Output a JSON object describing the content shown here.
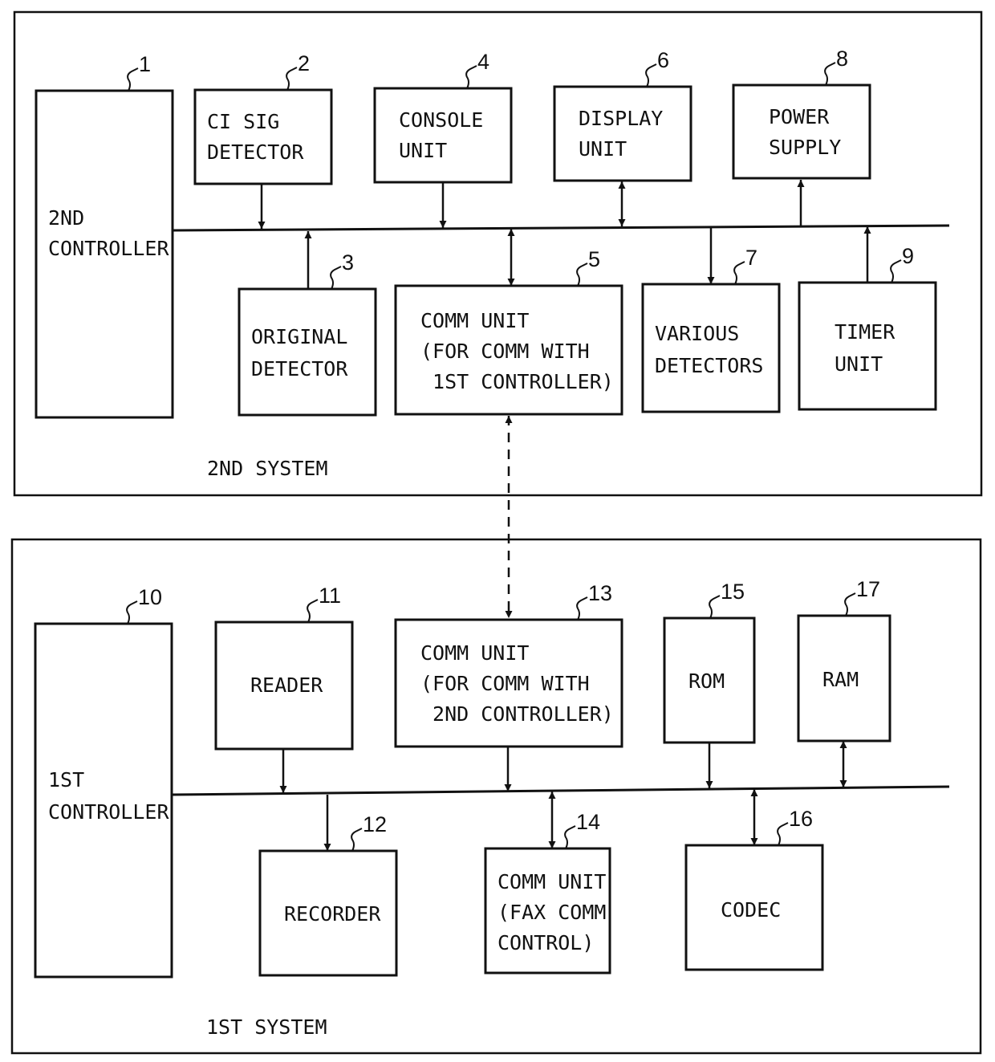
{
  "systems": [
    {
      "id": "second",
      "label": "2ND SYSTEM"
    },
    {
      "id": "first",
      "label": "1ST SYSTEM"
    }
  ],
  "blocks": [
    {
      "ref": "1",
      "lines": [
        "2ND",
        "CONTROLLER"
      ],
      "name": "second-controller"
    },
    {
      "ref": "2",
      "lines": [
        "CI SIG",
        "DETECTOR"
      ],
      "name": "ci-sig-detector"
    },
    {
      "ref": "3",
      "lines": [
        "ORIGINAL",
        "DETECTOR"
      ],
      "name": "original-detector"
    },
    {
      "ref": "4",
      "lines": [
        "CONSOLE",
        "UNIT"
      ],
      "name": "console-unit"
    },
    {
      "ref": "5",
      "lines": [
        "COMM UNIT",
        "(FOR COMM WITH",
        " 1ST CONTROLLER)"
      ],
      "name": "comm-unit-second"
    },
    {
      "ref": "6",
      "lines": [
        "DISPLAY",
        "UNIT"
      ],
      "name": "display-unit"
    },
    {
      "ref": "7",
      "lines": [
        "VARIOUS",
        "DETECTORS"
      ],
      "name": "various-detectors"
    },
    {
      "ref": "8",
      "lines": [
        "POWER",
        "SUPPLY"
      ],
      "name": "power-supply"
    },
    {
      "ref": "9",
      "lines": [
        "TIMER",
        "UNIT"
      ],
      "name": "timer-unit"
    },
    {
      "ref": "10",
      "lines": [
        "1ST",
        "CONTROLLER"
      ],
      "name": "first-controller"
    },
    {
      "ref": "11",
      "lines": [
        "READER"
      ],
      "name": "reader"
    },
    {
      "ref": "12",
      "lines": [
        "RECORDER"
      ],
      "name": "recorder"
    },
    {
      "ref": "13",
      "lines": [
        "COMM UNIT",
        "(FOR COMM WITH",
        " 2ND CONTROLLER)"
      ],
      "name": "comm-unit-first"
    },
    {
      "ref": "14",
      "lines": [
        "COMM UNIT",
        "(FAX COMM",
        "CONTROL)"
      ],
      "name": "comm-unit-fax"
    },
    {
      "ref": "15",
      "lines": [
        "ROM"
      ],
      "name": "rom"
    },
    {
      "ref": "16",
      "lines": [
        "CODEC"
      ],
      "name": "codec"
    },
    {
      "ref": "17",
      "lines": [
        "RAM"
      ],
      "name": "ram"
    }
  ],
  "connections": [
    {
      "from": "2",
      "to": "bus-second",
      "direction": "to-bus"
    },
    {
      "from": "4",
      "to": "bus-second",
      "direction": "to-bus"
    },
    {
      "from": "6",
      "to": "bus-second",
      "direction": "bidirectional"
    },
    {
      "from": "bus-second",
      "to": "8",
      "direction": "from-bus"
    },
    {
      "from": "3",
      "to": "bus-second",
      "direction": "to-bus"
    },
    {
      "from": "5",
      "to": "bus-second",
      "direction": "bidirectional"
    },
    {
      "from": "bus-second",
      "to": "7",
      "direction": "from-bus"
    },
    {
      "from": "9",
      "to": "bus-second",
      "direction": "to-bus"
    },
    {
      "from": "5",
      "to": "13",
      "direction": "bidirectional",
      "style": "dashed"
    },
    {
      "from": "11",
      "to": "bus-first",
      "direction": "to-bus"
    },
    {
      "from": "13",
      "to": "bus-first",
      "direction": "to-bus"
    },
    {
      "from": "15",
      "to": "bus-first",
      "direction": "to-bus"
    },
    {
      "from": "17",
      "to": "bus-first",
      "direction": "bidirectional"
    },
    {
      "from": "bus-first",
      "to": "12",
      "direction": "from-bus"
    },
    {
      "from": "14",
      "to": "bus-first",
      "direction": "bidirectional"
    },
    {
      "from": "16",
      "to": "bus-first",
      "direction": "bidirectional"
    }
  ]
}
